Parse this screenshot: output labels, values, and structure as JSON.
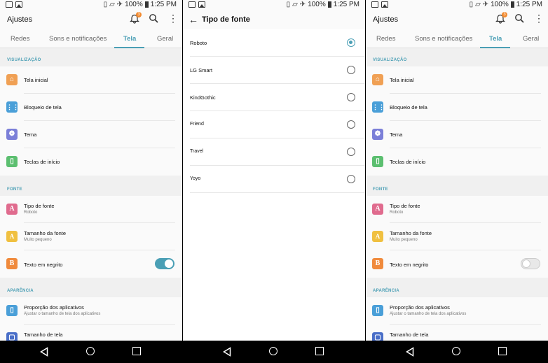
{
  "status_bar": {
    "battery": "100%",
    "time": "1:25 PM"
  },
  "settings": {
    "title": "Ajustes",
    "notification_count": "3",
    "tabs": [
      "Redes",
      "Sons e notificações",
      "Tela",
      "Geral"
    ],
    "active_tab": "Tela",
    "sections": {
      "visualizacao": "VISUALIZAÇÃO",
      "fonte": "FONTE",
      "aparencia": "APARÊNCIA"
    },
    "items": {
      "tela_inicial": "Tela inicial",
      "bloqueio": "Bloqueio de tela",
      "tema": "Tema",
      "teclas": "Teclas de início",
      "tipo_fonte": "Tipo de fonte",
      "tipo_fonte_sub": "Roboto",
      "tamanho_fonte": "Tamanho da fonte",
      "tamanho_fonte_sub": "Muito pequeno",
      "negrito": "Texto em negrito",
      "proporcao": "Proporção dos aplicativos",
      "proporcao_sub": "Ajustar o tamanho de tela dos aplicativos",
      "tamanho_tela": "Tamanho de tela"
    },
    "bold_text_left": true,
    "bold_text_right": false
  },
  "font_picker": {
    "title": "Tipo de fonte",
    "options": [
      "Roboto",
      "LG Smart",
      "KindGothic",
      "Friend",
      "Travel",
      "Yoyo"
    ],
    "selected": "Roboto"
  },
  "colors": {
    "accent": "#4a9fb5",
    "home_icon": "#f0a054",
    "lock_icon": "#4a9fd8",
    "theme_icon": "#7b7fd8",
    "keys_icon": "#5cbf70",
    "font_icon": "#e06b8e",
    "size_icon": "#f0c040",
    "bold_icon": "#f08a3c",
    "ratio_icon": "#4a9fd8"
  }
}
